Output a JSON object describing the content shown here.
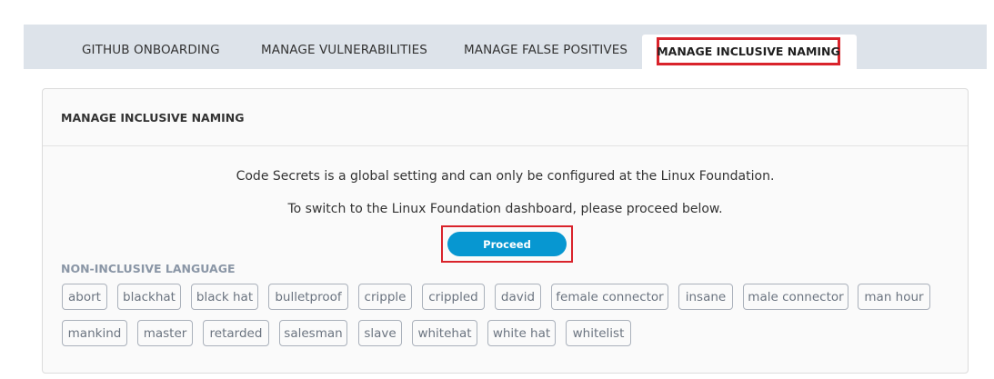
{
  "tabs": {
    "github_onboarding": "GITHUB ONBOARDING",
    "manage_vulnerabilities": "MANAGE VULNERABILITIES",
    "manage_false_positives": "MANAGE FALSE POSITIVES",
    "manage_inclusive_naming": "MANAGE INCLUSIVE NAMING"
  },
  "panel": {
    "title": "MANAGE INCLUSIVE NAMING",
    "message_1": "Code Secrets is a global setting and can only be configured at the Linux Foundation.",
    "message_2": "To switch to the Linux Foundation dashboard, please proceed below.",
    "proceed_label": "Proceed",
    "language_title": "NON-INCLUSIVE LANGUAGE",
    "terms": [
      "abort",
      "blackhat",
      "black hat",
      "bulletproof",
      "cripple",
      "crippled",
      "david",
      "female connector",
      "insane",
      "male connector",
      "man hour",
      "mankind",
      "master",
      "retarded",
      "salesman",
      "slave",
      "whitehat",
      "white hat",
      "whitelist"
    ]
  },
  "colors": {
    "highlight": "#d9232b",
    "accent_button": "#0797d1",
    "tabbar_bg": "#dde3ea"
  }
}
